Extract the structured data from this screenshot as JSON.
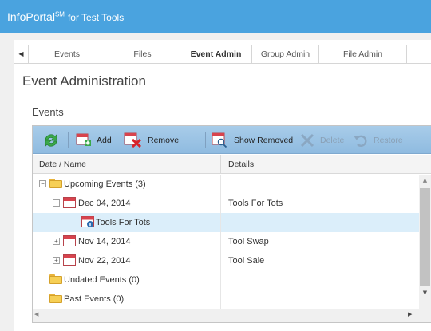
{
  "header": {
    "brand": "InfoPortal",
    "brand_mark": "SM",
    "brand_sub": "for Test Tools"
  },
  "tabs": [
    {
      "label": "Events"
    },
    {
      "label": "Files"
    },
    {
      "label": "Event Admin",
      "active": true
    },
    {
      "label": "Group Admin"
    },
    {
      "label": "File Admin"
    }
  ],
  "page": {
    "title": "Event Administration",
    "section": "Events"
  },
  "toolbar": {
    "refresh_icon": "refresh-icon",
    "add_label": "Add",
    "remove_label": "Remove",
    "show_removed_label": "Show Removed",
    "delete_label": "Delete",
    "restore_label": "Restore"
  },
  "grid": {
    "columns": {
      "name": "Date / Name",
      "details": "Details"
    },
    "rows": [
      {
        "name": "Upcoming Events (3)",
        "details": ""
      },
      {
        "name": "Dec 04, 2014",
        "details": "Tools For Tots"
      },
      {
        "name": "Tools For Tots",
        "details": ""
      },
      {
        "name": "Nov 14, 2014",
        "details": "Tool Swap"
      },
      {
        "name": "Nov 22, 2014",
        "details": "Tool Sale"
      },
      {
        "name": "Undated Events (0)",
        "details": ""
      },
      {
        "name": "Past Events (0)",
        "details": ""
      }
    ]
  },
  "colors": {
    "header_bg": "#4aa3df",
    "toolbar_bg": "#9cc4e4",
    "selected_row": "#dbeefa",
    "accent_green": "#3aa84a",
    "accent_red": "#d8434d"
  }
}
